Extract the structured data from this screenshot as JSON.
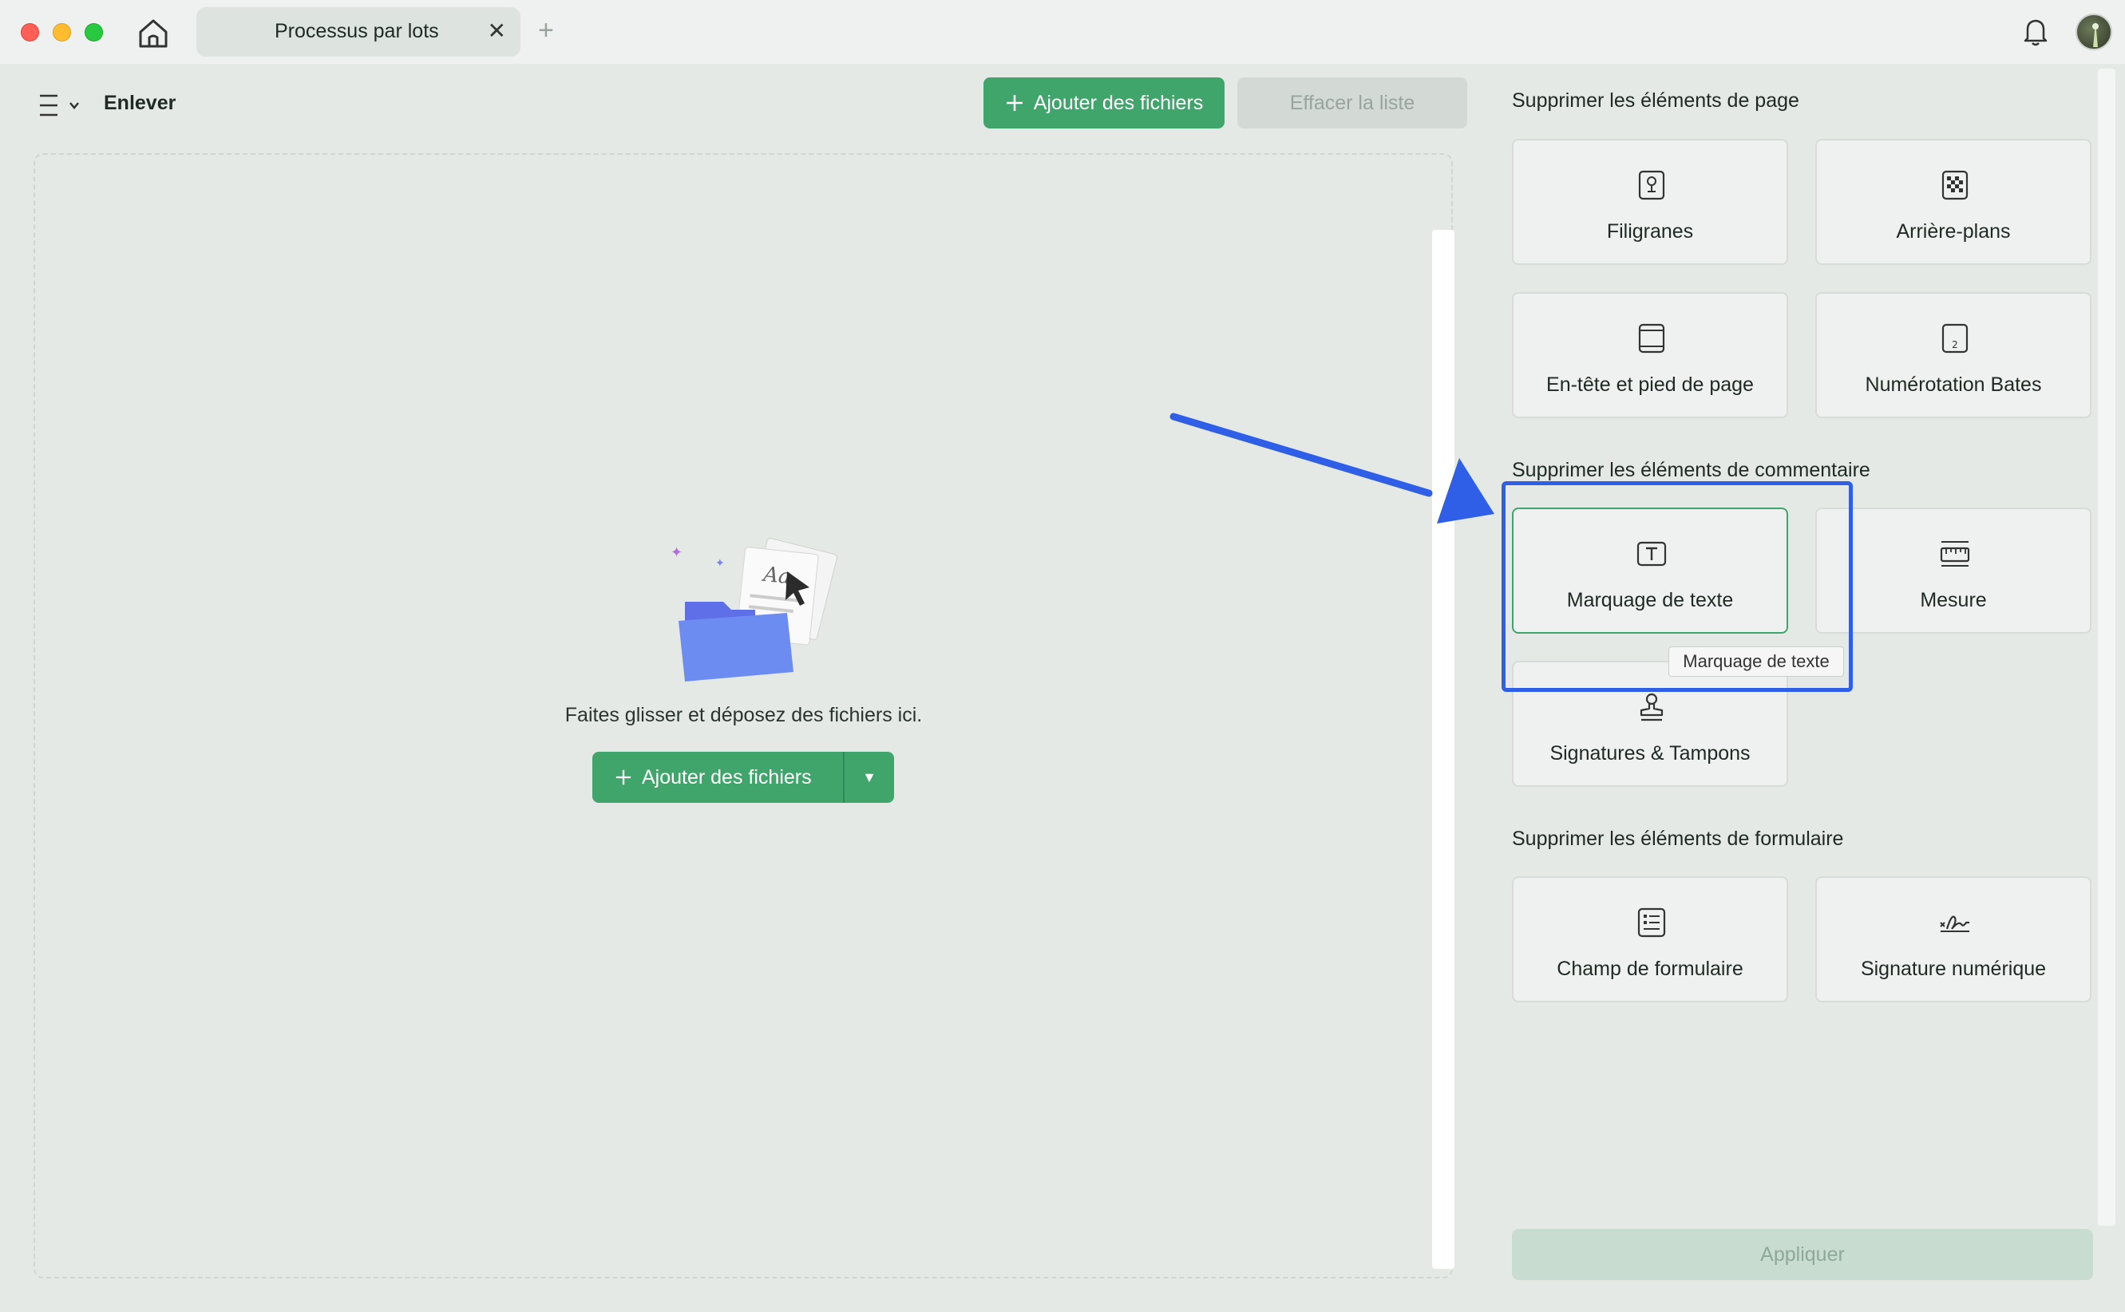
{
  "window": {
    "tab_title": "Processus par lots",
    "tab_close": "✕",
    "new_tab": "+"
  },
  "left_panel": {
    "title": "Enlever",
    "add_files_label": "Ajouter des fichiers",
    "clear_list_label": "Effacer la liste",
    "drop_text": "Faites glisser et déposez des fichiers ici.",
    "add_files_main_label": "Ajouter des fichiers",
    "dropdown_caret": "▼"
  },
  "right_panel": {
    "sections": {
      "page": {
        "title": "Supprimer les éléments de page",
        "items": [
          "Filigranes",
          "Arrière-plans",
          "En-tête et pied de page",
          "Numérotation Bates"
        ]
      },
      "comment": {
        "title": "Supprimer les éléments de commentaire",
        "items": [
          "Marquage de texte",
          "Mesure",
          "Signatures & Tampons"
        ]
      },
      "form": {
        "title": "Supprimer les éléments de formulaire",
        "items": [
          "Champ de formulaire",
          "Signature numérique"
        ]
      }
    },
    "tooltip": "Marquage de texte",
    "apply_label": "Appliquer"
  },
  "icons": {
    "home": "home-icon",
    "bell": "bell-icon",
    "menu": "menu-icon",
    "plus": "plus-icon",
    "watermark": "watermark-icon",
    "background": "checkerboard-icon",
    "header_footer": "header-footer-icon",
    "bates": "bates-number-icon",
    "text_markup": "text-markup-icon",
    "measure": "ruler-icon",
    "stamp": "stamp-icon",
    "form_field": "form-field-icon",
    "digital_signature": "signature-icon"
  },
  "colors": {
    "accent_green": "#40a56b",
    "annotation_blue": "#2f5fe6"
  }
}
